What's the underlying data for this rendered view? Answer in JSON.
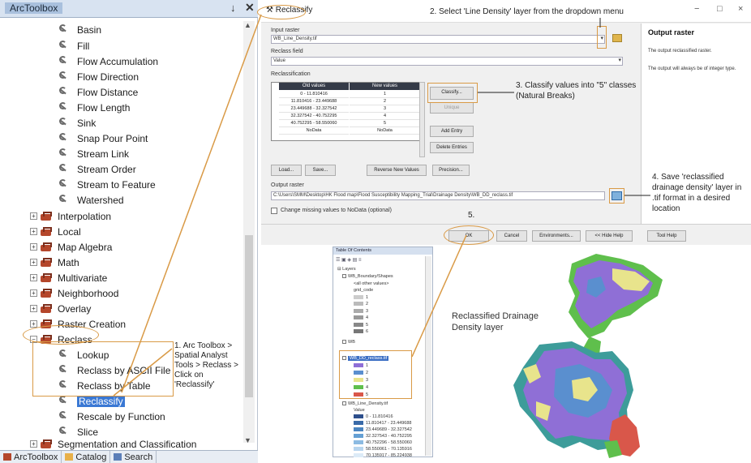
{
  "toolbox": {
    "title": "ArcToolbox",
    "pin_icon": "pin-icon",
    "close_icon": "close-icon",
    "tools_top": [
      "Basin",
      "Fill",
      "Flow Accumulation",
      "Flow Direction",
      "Flow Distance",
      "Flow Length",
      "Sink",
      "Snap Pour Point",
      "Stream Link",
      "Stream Order",
      "Stream to Feature",
      "Watershed"
    ],
    "toolsets": [
      "Interpolation",
      "Local",
      "Map Algebra",
      "Math",
      "Multivariate",
      "Neighborhood",
      "Overlay",
      "Raster Creation",
      "Reclass"
    ],
    "reclass_tools": [
      "Lookup",
      "Reclass by ASCII File",
      "Reclass by Table",
      "Reclassify",
      "Rescale by Function",
      "Slice"
    ],
    "last_toolset": "Segmentation and Classification",
    "bottom_tabs": [
      "ArcToolbox",
      "Catalog",
      "Search"
    ]
  },
  "dialog": {
    "title": "Reclassify",
    "input_raster_label": "Input raster",
    "input_raster_value": "WB_Line_Density.tif",
    "reclass_field_label": "Reclass field",
    "reclass_field_value": "Value",
    "reclassification_label": "Reclassification",
    "table_headers": [
      "Old values",
      "New values"
    ],
    "table_rows": [
      [
        "0 - 11.810416",
        "1"
      ],
      [
        "11.810416 - 23.449688",
        "2"
      ],
      [
        "23.449688 - 32.327542",
        "3"
      ],
      [
        "32.327542 - 40.752295",
        "4"
      ],
      [
        "40.752295 - 58.550060",
        "5"
      ],
      [
        "NoData",
        "NoData"
      ]
    ],
    "buttons": {
      "classify": "Classify...",
      "unique": "Unique",
      "add_entry": "Add Entry",
      "delete_entries": "Delete Entries",
      "load": "Load...",
      "save": "Save...",
      "reverse": "Reverse New Values",
      "precision": "Precision..."
    },
    "output_raster_label": "Output raster",
    "output_raster_value": "C:\\Users\\SMM\\Desktop\\HK Flood map\\Flood Susceptibility Mapping_Trial\\Drainage Density\\WB_DD_reclass.tif",
    "nodata_checkbox": "Change missing values to NoData (optional)",
    "bottom_buttons": [
      "OK",
      "Cancel",
      "Environments...",
      "<< Hide Help",
      "Tool Help"
    ],
    "window_controls": [
      "−",
      "□",
      "×"
    ],
    "help": {
      "heading": "Output raster",
      "line1": "The output reclassified raster.",
      "line2": "The output will always be of integer type."
    }
  },
  "toc": {
    "title": "Table Of Contents",
    "tools": "☰ ▣ ◈ ▤ ≡",
    "layers_label": "Layers",
    "items": [
      "WB_Boundary/Shapes",
      "<all other values>",
      "grid_code",
      "1",
      "2",
      "3",
      "4",
      "5",
      "6",
      "WB"
    ],
    "selected_layer": "WB_DD_reclass.tif",
    "selected_classes": [
      "1",
      "2",
      "3",
      "4",
      "5"
    ],
    "density_layer": "WB_Line_Density.tif",
    "density_value_label": "Value",
    "density_classes": [
      "0 - 11.810416",
      "11.810417 - 23.449688",
      "23.449689 - 32.327542",
      "32.327543 - 40.752295",
      "40.752296 - 58.550060",
      "58.550061 - 70.135916",
      "70.135917 - 85.224938"
    ]
  },
  "annotations": {
    "step1": "1. Arc Toolbox > Spatial Analyst Tools > Reclass > Click on 'Reclassify'",
    "step2": "2. Select 'Line Density' layer from the dropdown menu",
    "step3": "3. Classify values into \"5\" classes (Natural Breaks)",
    "step4": "4. Save 'reclassified drainage density' layer in .tif format in a desired location",
    "step5": "5.",
    "map_label": "Reclassified Drainage Density layer"
  },
  "colors": {
    "annotation_line": "#d99a46",
    "class_colors": [
      "#8f6fd6",
      "#5a8fcf",
      "#3d9c9a",
      "#e8e48c",
      "#5fbf4c",
      "#d9574a"
    ]
  }
}
